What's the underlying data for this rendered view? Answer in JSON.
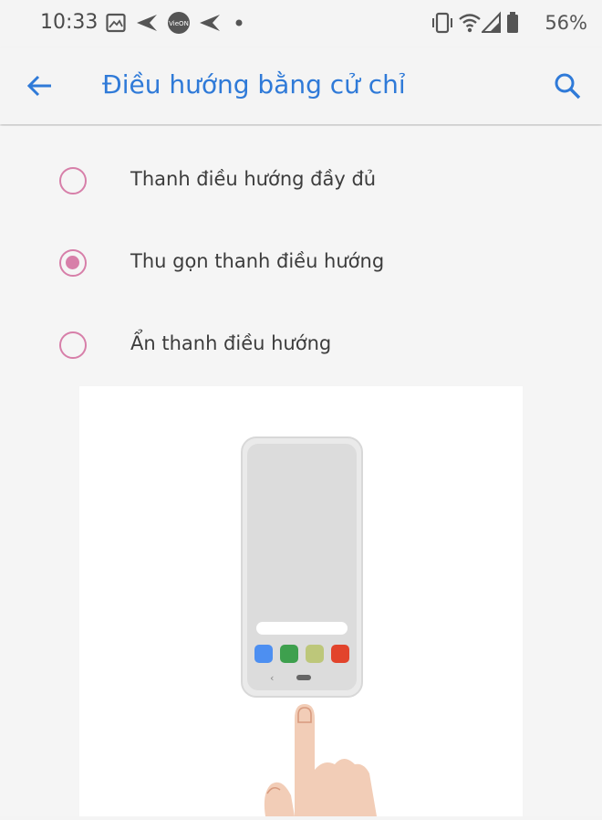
{
  "status_bar": {
    "time": "10:33",
    "battery": "56%",
    "icons": [
      "gallery-icon",
      "send-icon",
      "vieon-app-icon",
      "send-icon",
      "notification-dot-icon",
      "vibrate-icon",
      "wifi-icon",
      "signal-icon",
      "battery-icon"
    ],
    "app_badge": "VieON"
  },
  "app_bar": {
    "title": "Điều hướng bằng cử chỉ",
    "back_icon": "arrow-back-icon",
    "search_icon": "search-icon"
  },
  "options": [
    {
      "label": "Thanh điều hướng đầy đủ",
      "selected": false
    },
    {
      "label": "Thu gọn thanh điều hướng",
      "selected": true
    },
    {
      "label": "Ẩn thanh điều hướng",
      "selected": false
    }
  ],
  "illustration": {
    "description_icon": "phone-gesture-illustration",
    "dock_colors": [
      "#4d8ff1",
      "#3ea04e",
      "#bdc77a",
      "#e2442c"
    ]
  },
  "colors": {
    "accent": "#2f7ad8",
    "radio": "#d77fa9",
    "background": "#f5f5f5"
  }
}
